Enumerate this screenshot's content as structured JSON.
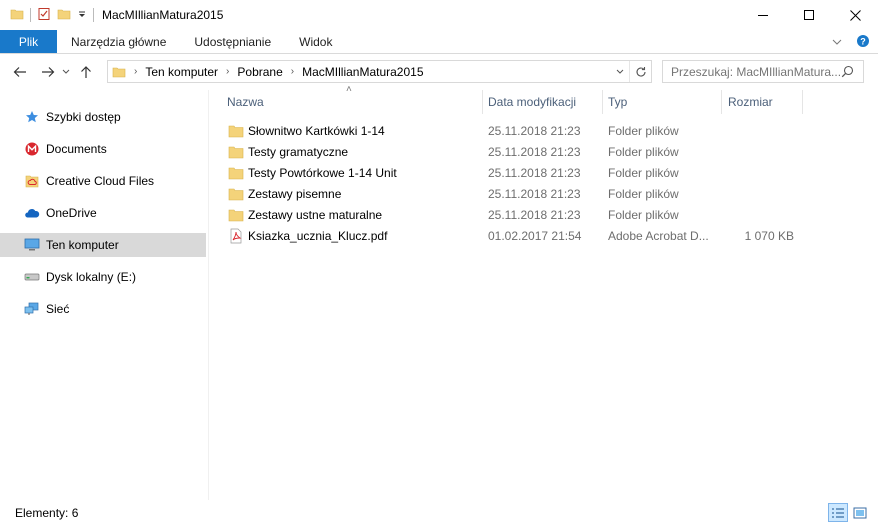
{
  "window": {
    "title": "MacMIllianMatura2015"
  },
  "ribbon": {
    "tabs": [
      "Plik",
      "Narzędzia główne",
      "Udostępnianie",
      "Widok"
    ]
  },
  "address": {
    "crumbs": [
      "Ten komputer",
      "Pobrane",
      "MacMIllianMatura2015"
    ]
  },
  "search": {
    "placeholder": "Przeszukaj: MacMIllianMatura..."
  },
  "nav": {
    "items": [
      {
        "label": "Szybki dostęp",
        "icon": "star-icon"
      },
      {
        "label": "Documents",
        "icon": "mega-icon"
      },
      {
        "label": "Creative Cloud Files",
        "icon": "creative-cloud-folder-icon"
      },
      {
        "label": "OneDrive",
        "icon": "onedrive-cloud-icon"
      },
      {
        "label": "Ten komputer",
        "icon": "computer-icon",
        "selected": true
      },
      {
        "label": "Dysk lokalny (E:)",
        "icon": "drive-icon"
      },
      {
        "label": "Sieć",
        "icon": "network-icon"
      }
    ]
  },
  "columns": [
    "Nazwa",
    "Data modyfikacji",
    "Typ",
    "Rozmiar"
  ],
  "files": [
    {
      "name": "Słownitwo Kartkówki 1-14",
      "date": "25.11.2018 21:23",
      "type": "Folder plików",
      "size": "",
      "icon": "folder-icon"
    },
    {
      "name": "Testy gramatyczne",
      "date": "25.11.2018 21:23",
      "type": "Folder plików",
      "size": "",
      "icon": "folder-icon"
    },
    {
      "name": "Testy Powtórkowe 1-14 Unit",
      "date": "25.11.2018 21:23",
      "type": "Folder plików",
      "size": "",
      "icon": "folder-icon"
    },
    {
      "name": "Zestawy pisemne",
      "date": "25.11.2018 21:23",
      "type": "Folder plików",
      "size": "",
      "icon": "folder-icon"
    },
    {
      "name": "Zestawy ustne maturalne",
      "date": "25.11.2018 21:23",
      "type": "Folder plików",
      "size": "",
      "icon": "folder-icon"
    },
    {
      "name": "Ksiazka_ucznia_Klucz.pdf",
      "date": "01.02.2017 21:54",
      "type": "Adobe Acrobat D...",
      "size": "1 070 KB",
      "icon": "pdf-icon"
    }
  ],
  "status": {
    "count": "Elementy: 6"
  },
  "colors": {
    "accent": "#1979ca",
    "folder": "#f4d37a",
    "selected_nav": "#d9d9d9"
  }
}
